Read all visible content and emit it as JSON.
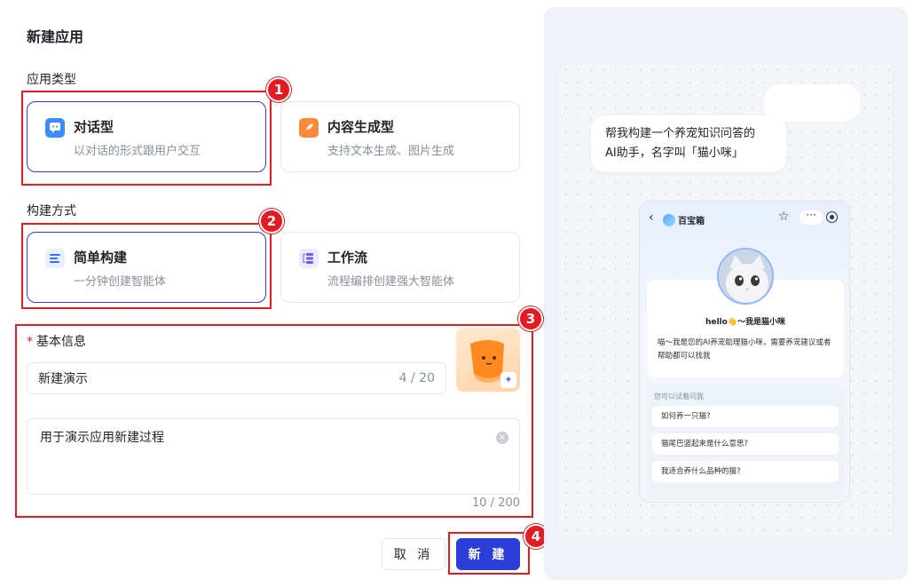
{
  "dialog": {
    "title": "新建应用"
  },
  "app_type": {
    "label": "应用类型",
    "options": [
      {
        "title": "对话型",
        "desc": "以对话的形式跟用户交互"
      },
      {
        "title": "内容生成型",
        "desc": "支持文本生成、图片生成"
      }
    ]
  },
  "build_method": {
    "label": "构建方式",
    "options": [
      {
        "title": "简单构建",
        "desc": "一分钟创建智能体"
      },
      {
        "title": "工作流",
        "desc": "流程编排创建强大智能体"
      }
    ]
  },
  "basic_info": {
    "label": "基本信息",
    "required_mark": "*",
    "name_value": "新建演示",
    "name_count": "4 / 20",
    "desc_value": "用于演示应用新建过程",
    "desc_count": "10 / 200"
  },
  "actions": {
    "cancel": "取 消",
    "create": "新 建"
  },
  "badges": [
    "1",
    "2",
    "3",
    "4"
  ],
  "preview": {
    "user_bubble_line1": "帮我构建一个养宠知识问答的",
    "user_bubble_line2": "AI助手，名字叫「猫小咪」",
    "phone": {
      "app_name": "百宝箱",
      "back": "‹",
      "star": "☆",
      "more": "···",
      "hello": "hello👋～我是猫小咪",
      "intro": "喵～我是您的AI养宠助理猫小咪，需要养宠建议或者帮助都可以找我",
      "questions_title": "您可以试着问我",
      "questions": [
        "如何养一只猫?",
        "猫尾巴竖起来是什么意思?",
        "我适合养什么品种的猫?"
      ]
    }
  },
  "colors": {
    "primary": "#2b3dd8",
    "highlight": "#e31b23"
  }
}
